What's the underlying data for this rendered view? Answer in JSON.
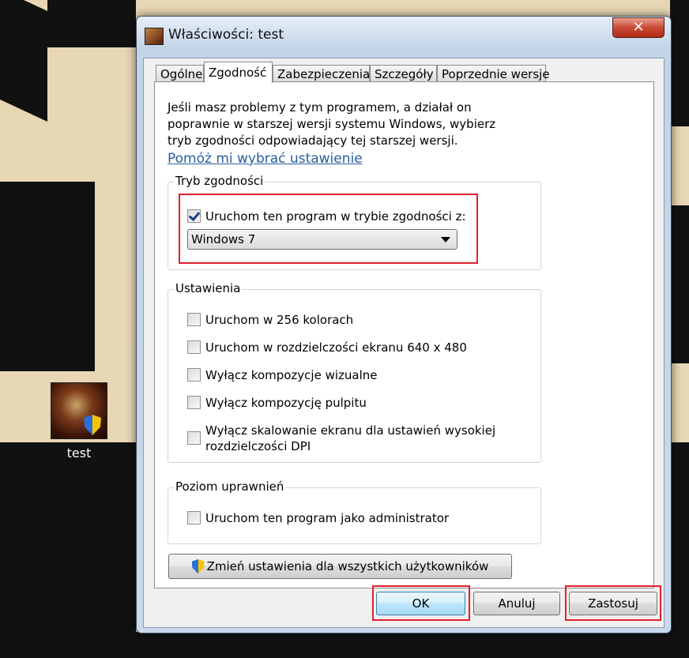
{
  "desktop": {
    "icon_label": "test"
  },
  "window": {
    "title": "Właściwości: test",
    "close_symbol": "✕"
  },
  "tabs": [
    {
      "label": "Ogólne",
      "active": false
    },
    {
      "label": "Zgodność",
      "active": true
    },
    {
      "label": "Zabezpieczenia",
      "active": false
    },
    {
      "label": "Szczegóły",
      "active": false
    },
    {
      "label": "Poprzednie wersje",
      "active": false
    }
  ],
  "compat": {
    "intro": "Jeśli masz problemy z tym programem, a działał on poprawnie w starszej wersji systemu Windows, wybierz tryb zgodności odpowiadający tej starszej wersji.",
    "help_link": "Pomóż mi wybrać ustawienie",
    "mode_group": {
      "legend": "Tryb zgodności",
      "checkbox_label": "Uruchom ten program w trybie zgodności z:",
      "checked": true,
      "selected_os": "Windows 7"
    },
    "settings_group": {
      "legend": "Ustawienia",
      "options": [
        {
          "label": "Uruchom w 256 kolorach",
          "checked": false
        },
        {
          "label": "Uruchom w rozdzielczości ekranu 640 x 480",
          "checked": false
        },
        {
          "label": "Wyłącz kompozycje wizualne",
          "checked": false
        },
        {
          "label": "Wyłącz kompozycję pulpitu",
          "checked": false
        },
        {
          "label": "Wyłącz skalowanie ekranu dla ustawień wysokiej rozdzielczości DPI",
          "checked": false
        }
      ]
    },
    "privilege_group": {
      "legend": "Poziom uprawnień",
      "option": {
        "label": "Uruchom ten program jako administrator",
        "checked": false
      }
    },
    "all_users_button": "Zmień ustawienia dla wszystkich użytkowników"
  },
  "footer": {
    "ok": "OK",
    "cancel": "Anuluj",
    "apply": "Zastosuj"
  },
  "colors": {
    "highlight_box": "#e0202c",
    "link": "#2a5d9c"
  }
}
